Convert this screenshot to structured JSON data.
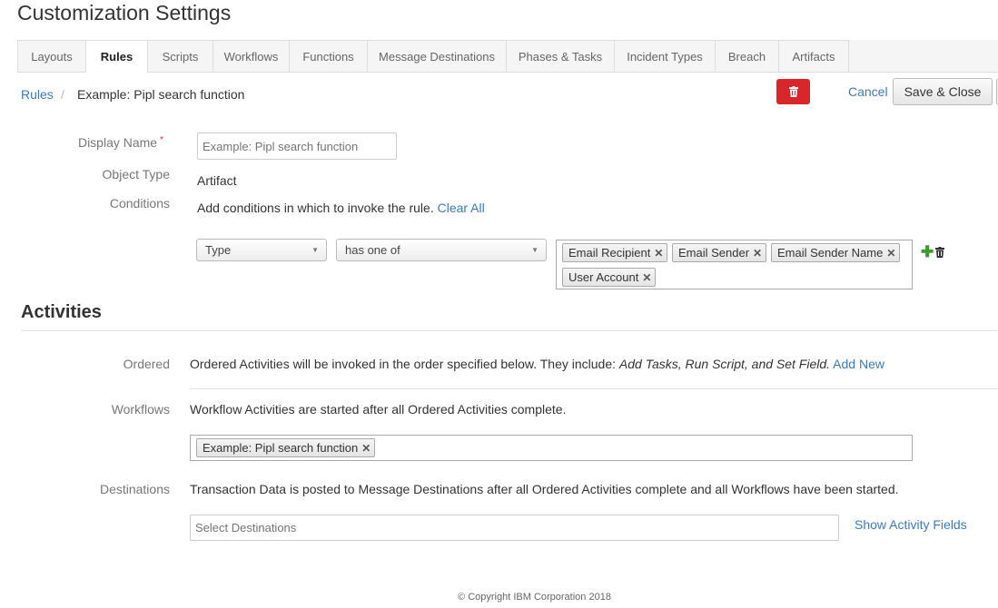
{
  "page": {
    "title": "Customization Settings"
  },
  "tabs": [
    {
      "label": "Layouts"
    },
    {
      "label": "Rules"
    },
    {
      "label": "Scripts"
    },
    {
      "label": "Workflows"
    },
    {
      "label": "Functions"
    },
    {
      "label": "Message Destinations"
    },
    {
      "label": "Phases & Tasks"
    },
    {
      "label": "Incident Types"
    },
    {
      "label": "Breach"
    },
    {
      "label": "Artifacts"
    }
  ],
  "breadcrumb": {
    "parent": "Rules",
    "separator": "/",
    "current": "Example: Pipl search function"
  },
  "toolbar": {
    "cancel_label": "Cancel",
    "save_close_label": "Save & Close"
  },
  "form": {
    "display_name": {
      "label": "Display Name",
      "required_mark": "*",
      "placeholder": "Example: Pipl search function"
    },
    "object_type": {
      "label": "Object Type",
      "value": "Artifact"
    },
    "conditions": {
      "label": "Conditions",
      "help_text": "Add conditions in which to invoke the rule.",
      "clear_all_label": "Clear All",
      "field_select": "Type",
      "operator_select": "has one of",
      "values": [
        "Email Recipient",
        "Email Sender",
        "Email Sender Name",
        "User Account"
      ]
    }
  },
  "activities": {
    "title": "Activities",
    "ordered": {
      "label": "Ordered",
      "text": "Ordered Activities will be invoked in the order specified below. They include:",
      "text_italic": "Add Tasks, Run Script, and Set Field.",
      "add_new_label": "Add New"
    },
    "workflows": {
      "label": "Workflows",
      "text": "Workflow Activities are started after all Ordered Activities complete.",
      "tags": [
        "Example: Pipl search function"
      ]
    },
    "destinations": {
      "label": "Destinations",
      "text": "Transaction Data is posted to Message Destinations after all Ordered Activities complete and all Workflows have been started.",
      "placeholder": "Select Destinations",
      "show_fields_label": "Show Activity Fields"
    }
  },
  "footer": {
    "copyright": "© Copyright IBM Corporation 2018"
  },
  "colors": {
    "link": "#3a7bbf",
    "danger": "#d9262b",
    "add": "#3e9a2e"
  }
}
